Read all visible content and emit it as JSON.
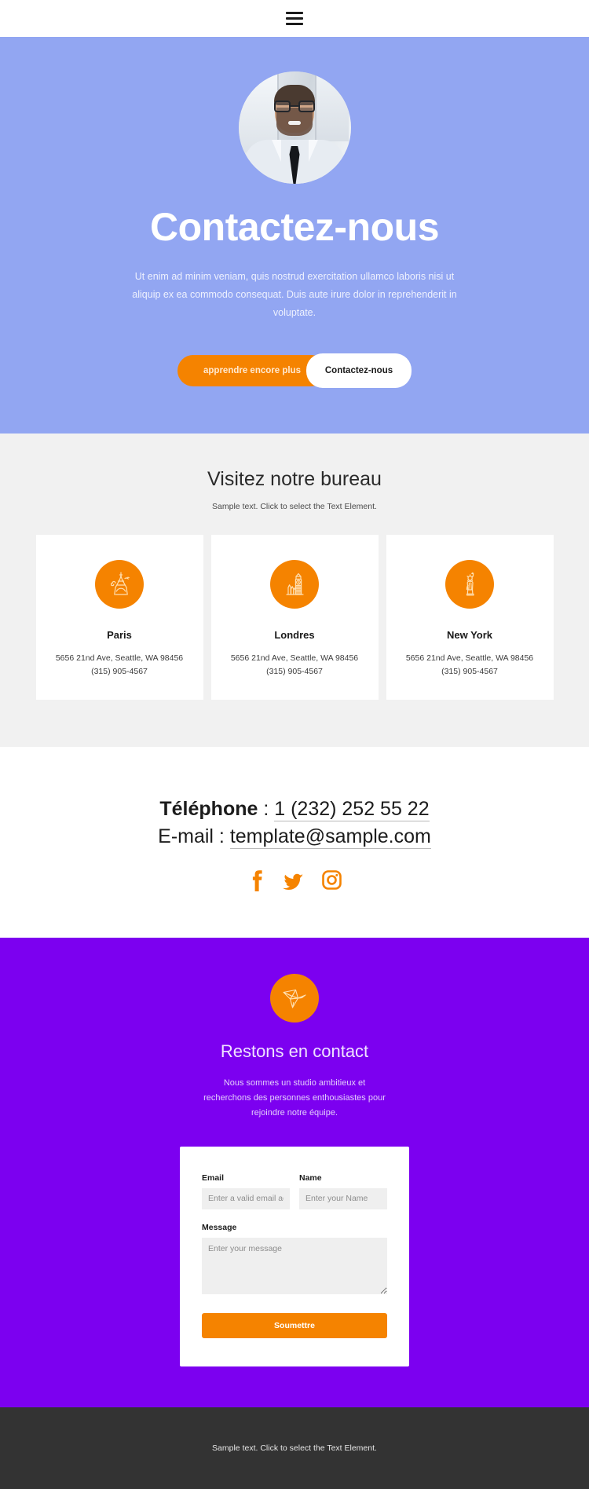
{
  "header": {
    "menu_icon": "hamburger-menu-icon"
  },
  "hero": {
    "avatar_alt": "portrait-photo",
    "title": "Contactez-nous",
    "subtitle": "Ut enim ad minim veniam, quis nostrud exercitation ullamco laboris nisi ut aliquip ex ea commodo consequat. Duis aute irure dolor in reprehenderit in voluptate.",
    "primary_button": "apprendre encore plus",
    "secondary_button": "Contactez-nous",
    "background_color": "#92a6f2",
    "accent_color": "#f58300"
  },
  "offices": {
    "title": "Visitez notre bureau",
    "subtitle": "Sample text. Click to select the Text Element.",
    "cards": [
      {
        "icon": "eiffel-tower-icon",
        "name": "Paris",
        "address": "5656 21nd Ave, Seattle, WA 98456",
        "phone": "(315) 905-4567"
      },
      {
        "icon": "big-ben-icon",
        "name": "Londres",
        "address": "5656 21nd Ave, Seattle, WA 98456",
        "phone": "(315) 905-4567"
      },
      {
        "icon": "statue-of-liberty-icon",
        "name": "New York",
        "address": "5656 21nd Ave, Seattle, WA 98456",
        "phone": "(315) 905-4567"
      }
    ]
  },
  "contact_info": {
    "phone_label": "Téléphone",
    "phone_separator": " : ",
    "phone_value": "1 (232) 252 55 22",
    "email_label": "E-mail",
    "email_separator": " : ",
    "email_value": "template@sample.com",
    "socials": [
      {
        "icon": "facebook-icon",
        "name": "Facebook"
      },
      {
        "icon": "twitter-icon",
        "name": "Twitter"
      },
      {
        "icon": "instagram-icon",
        "name": "Instagram"
      }
    ]
  },
  "cta": {
    "icon": "origami-bird-icon",
    "title": "Restons en contact",
    "subtitle": "Nous sommes un studio ambitieux et recherchons des personnes enthousiastes pour rejoindre notre équipe.",
    "background_color": "#7c00f0",
    "form": {
      "email_label": "Email",
      "email_placeholder": "Enter a valid email address",
      "name_label": "Name",
      "name_placeholder": "Enter your Name",
      "message_label": "Message",
      "message_placeholder": "Enter your message",
      "submit_label": "Soumettre"
    }
  },
  "footer": {
    "text": "Sample text. Click to select the Text Element.",
    "background_color": "#333333"
  }
}
